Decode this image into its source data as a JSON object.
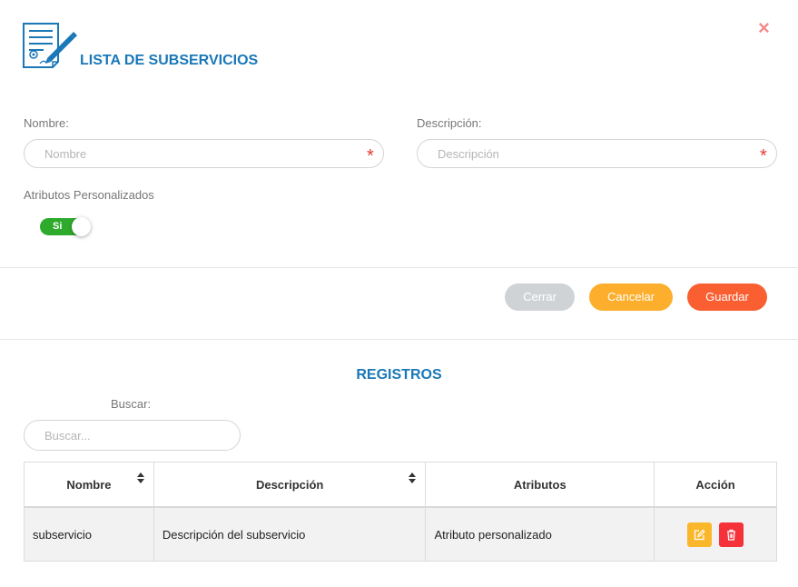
{
  "header": {
    "title": "LISTA DE SUBSERVICIOS",
    "close": "×"
  },
  "form": {
    "nombre_label": "Nombre:",
    "nombre_placeholder": "Nombre",
    "nombre_value": "",
    "descripcion_label": "Descripción:",
    "descripcion_placeholder": "Descripción",
    "descripcion_value": "",
    "required_mark": "*",
    "atributos_label": "Atributos Personalizados",
    "toggle_text": "Si",
    "toggle_on": true
  },
  "actions": {
    "cerrar": "Cerrar",
    "cancelar": "Cancelar",
    "guardar": "Guardar"
  },
  "colors": {
    "accent": "#1a78b8",
    "toggle_on": "#2eaa2c",
    "cancel": "#fcae2c",
    "save": "#fa5f32",
    "close_btn": "#d0d3d6",
    "edit": "#fbb72c",
    "delete": "#f5313a"
  },
  "registros": {
    "title": "REGISTROS",
    "search_label": "Buscar:",
    "search_placeholder": "Buscar...",
    "columns": [
      "Nombre",
      "Descripción",
      "Atributos",
      "Acción"
    ],
    "rows": [
      {
        "nombre": "subservicio",
        "descripcion": "Descripción del subservicio",
        "atributos": "Atributo personalizado"
      }
    ]
  },
  "icons": {
    "header": "document-edit-icon",
    "close": "close-icon",
    "sort": "sort-icon",
    "edit": "edit-icon",
    "delete": "trash-icon"
  }
}
